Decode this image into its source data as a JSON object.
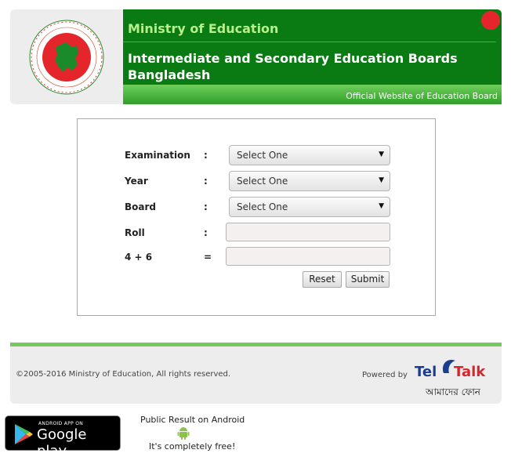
{
  "header": {
    "ministry_title": "Ministry of Education",
    "board_title": "Intermediate and Secondary Education Boards Bangladesh",
    "official_text": "Official Website of Education Board",
    "logo_text": "গণপ্রজাতন্ত্রী বাংলাদেশ সরকার"
  },
  "form": {
    "examination": {
      "label": "Examination",
      "colon": ":",
      "value": "Select One"
    },
    "year": {
      "label": "Year",
      "colon": ":",
      "value": "Select One"
    },
    "board": {
      "label": "Board",
      "colon": ":",
      "value": "Select One"
    },
    "roll": {
      "label": "Roll",
      "colon": ":",
      "value": ""
    },
    "captcha": {
      "label": "4 + 6",
      "colon": "=",
      "value": ""
    },
    "reset_label": "Reset",
    "submit_label": "Submit"
  },
  "footer": {
    "copyright": "©2005-2016 Ministry of Education, All rights reserved.",
    "powered_by": "Powered by",
    "teletalk_tel": "Tel",
    "teletalk_talk": "Talk",
    "teletalk_tagline": "আমাদের ফোন"
  },
  "app": {
    "badge_small": "ANDROID APP ON",
    "badge_big": "Google play",
    "android_text": "Public Result on Android",
    "free_text": "It's completely free!"
  },
  "colors": {
    "banner_green": "#0a7a12",
    "accent_light_green": "#b7f08a",
    "flag_red": "#e4262c",
    "teletalk_red": "#d7262e"
  }
}
